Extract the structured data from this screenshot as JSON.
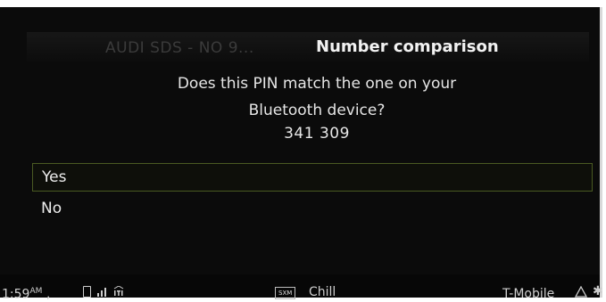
{
  "dialog": {
    "background_title": "AUDI SDS - NO 9...",
    "title": "Number comparison",
    "question_line1": "Does this PIN match the one on your",
    "question_line2": "Bluetooth device?",
    "pin": "341 309",
    "options": [
      {
        "label": "Yes",
        "selected": true
      },
      {
        "label": "No",
        "selected": false
      }
    ]
  },
  "status_bar": {
    "time": "1:59",
    "ampm": "AM",
    "separator": ",",
    "phone_icon": "phone-icon",
    "signal_icon": "signal-icon",
    "lte_icon": "lte-icon",
    "source_badge": "SXM",
    "station": "Chill",
    "carrier": "T-Mobile",
    "warning_icon": "warning-icon",
    "bluetooth_icon": "bluetooth-icon"
  },
  "colors": {
    "selection_border": "#4a5a22",
    "background": "#0b0b0b",
    "text": "#e8e8e8"
  }
}
